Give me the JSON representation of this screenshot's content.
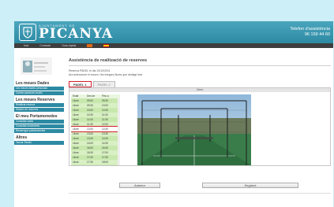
{
  "header": {
    "municipality": "AJUNTAMENT DE",
    "brand": "PICANYA",
    "phone_label": "Telefon d'assistència",
    "phone_number": "96 159 44 60"
  },
  "nav": {
    "items": [
      "Inici",
      "Contacte",
      "Guia ràpida"
    ]
  },
  "sidebar": {
    "sections": [
      {
        "title": "Les meues Dades",
        "links": [
          "Les meues dades personals",
          "Canvia password accés"
        ]
      },
      {
        "title": "Les meues Reserves",
        "links": [
          "Realitzar reserva",
          "Històric de reserves"
        ]
      },
      {
        "title": "El meu Portamonedes",
        "links": [
          "Consultar saldo",
          "Consultar moviments",
          "Recarregar portamonedes"
        ]
      },
      {
        "title": "Altres",
        "links": [
          "Tancar Sessió"
        ]
      }
    ]
  },
  "main": {
    "title": "Assistència de realització de reserves",
    "info_line1": "Reserva PADEL el dia 19/10/2011",
    "info_line2": "Ara seleccione el recurs i les franges lliures que desitge triar",
    "tabs": [
      "PADEL 1",
      "PADEL 2"
    ],
    "panel_title": "Lliure",
    "table_headers": [
      "Estat",
      "Des de",
      "Fins a"
    ],
    "rows": [
      [
        "Lliure",
        "09:00",
        "09:30"
      ],
      [
        "Lliure",
        "09:30",
        "10:00"
      ],
      [
        "Lliure",
        "10:00",
        "10:30"
      ],
      [
        "Lliure",
        "10:30",
        "11:00"
      ],
      [
        "Lliure",
        "11:00",
        "11:30"
      ],
      [
        "Lliure",
        "11:30",
        "12:00"
      ],
      [
        "Lliure",
        "12:00",
        "12:30"
      ],
      [
        "Lliure",
        "13:00",
        "13:30"
      ],
      [
        "Lliure",
        "13:30",
        "14:00"
      ],
      [
        "Lliure",
        "14:00",
        "14:30"
      ],
      [
        "Lliure",
        "16:00",
        "16:30"
      ],
      [
        "Lliure",
        "16:30",
        "17:00"
      ],
      [
        "Lliure",
        "17:00",
        "17:30"
      ],
      [
        "Lliure",
        "17:30",
        "18:00"
      ],
      [
        "Lliure",
        "18:00",
        "18:30"
      ]
    ],
    "selected_row": 6,
    "prev_button": "Anterior",
    "next_button": "Següent"
  }
}
